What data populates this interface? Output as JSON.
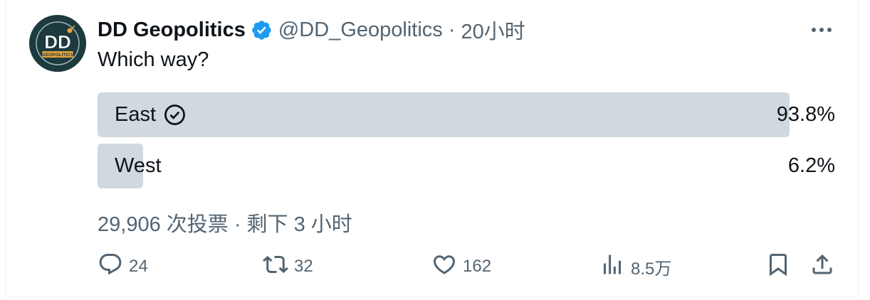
{
  "author": {
    "avatar_text": "DD",
    "avatar_subtext": "GEOPOLITICS",
    "name": "DD Geopolitics",
    "handle": "@DD_Geopolitics",
    "separator": "·",
    "time": "20小时"
  },
  "tweet": {
    "text": "Which way?"
  },
  "poll": {
    "options": [
      {
        "label": "East",
        "percent_text": "93.8%",
        "percent": 93.8,
        "winner": true
      },
      {
        "label": "West",
        "percent_text": "6.2%",
        "percent": 6.2,
        "winner": false
      }
    ],
    "meta": "29,906 次投票 · 剩下 3 小时"
  },
  "actions": {
    "replies": "24",
    "reposts": "32",
    "likes": "162",
    "views": "8.5万"
  },
  "colors": {
    "text": "#0f1419",
    "secondary": "#536471",
    "poll_bar": "#cfd9de",
    "verified": "#1d9bf0",
    "avatar_bg": "#1d3a3e",
    "avatar_accent": "#e8a33d"
  },
  "icons": [
    "verified-badge-icon",
    "more-icon",
    "check-circle-icon",
    "reply-icon",
    "repost-icon",
    "like-icon",
    "views-icon",
    "bookmark-icon",
    "share-icon"
  ]
}
